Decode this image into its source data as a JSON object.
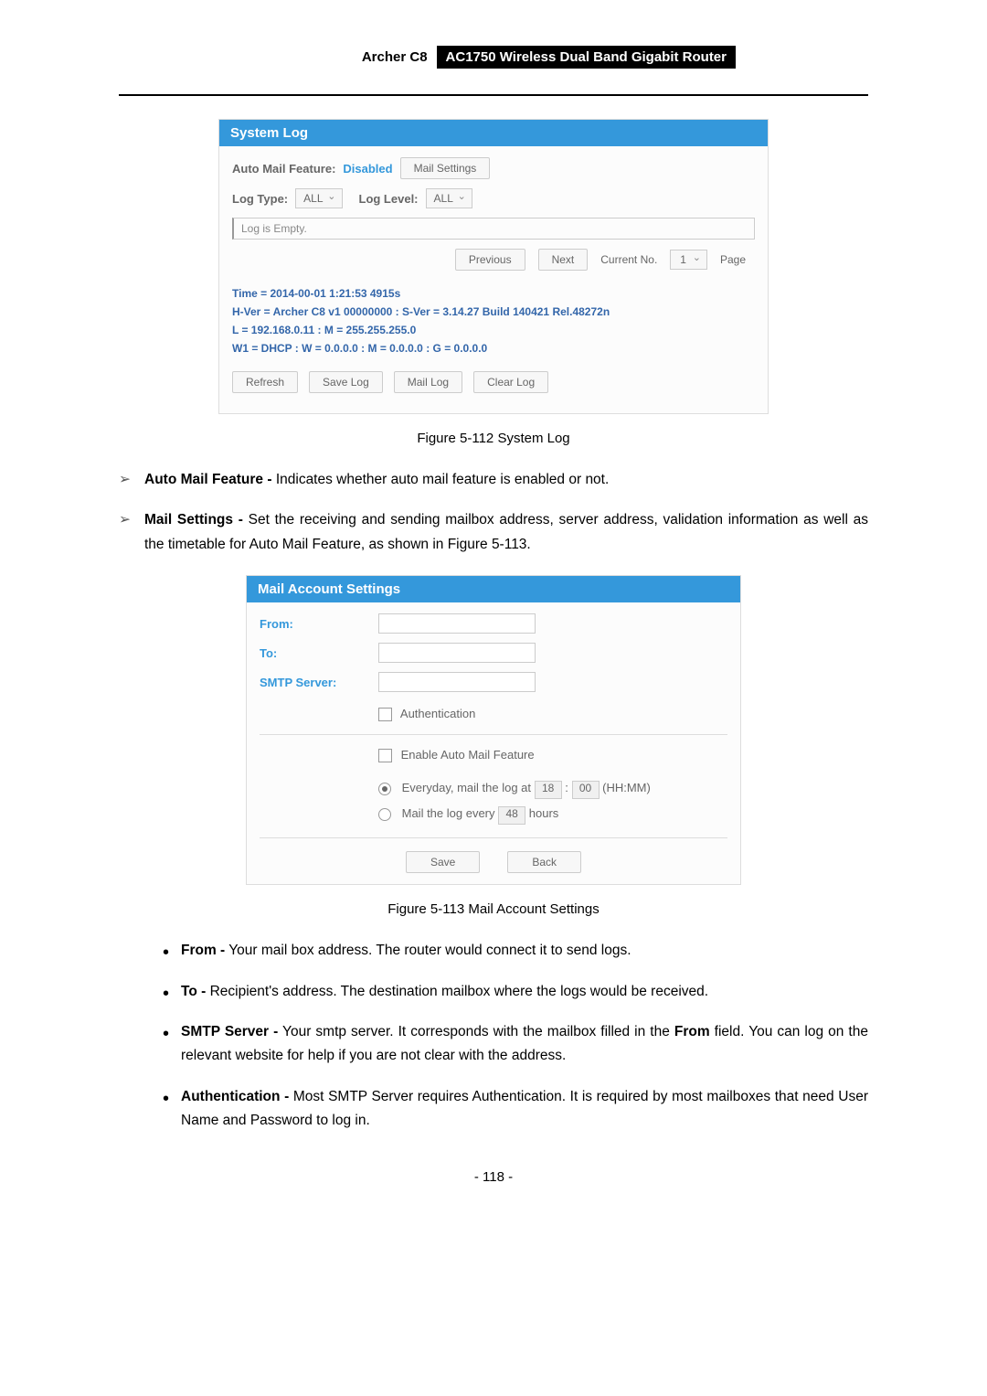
{
  "header": {
    "model": "Archer C8",
    "desc": "AC1750 Wireless Dual Band Gigabit Router"
  },
  "syslog": {
    "title": "System Log",
    "auto_mail_label": "Auto Mail Feature:",
    "auto_mail_value": "Disabled",
    "mail_settings_btn": "Mail Settings",
    "log_type_label": "Log Type:",
    "log_type_value": "ALL",
    "log_level_label": "Log Level:",
    "log_level_value": "ALL",
    "empty_text": "Log is Empty.",
    "prev_btn": "Previous",
    "next_btn": "Next",
    "current_no_label": "Current No.",
    "current_no_value": "1",
    "page_label": "Page",
    "info_time": "Time = 2014-00-01 1:21:53 4915s",
    "info_hver": "H-Ver = Archer C8 v1 00000000 : S-Ver = 3.14.27 Build 140421 Rel.48272n",
    "info_l": "L = 192.168.0.11 : M = 255.255.255.0",
    "info_w1": "W1 = DHCP : W = 0.0.0.0 : M = 0.0.0.0 : G = 0.0.0.0",
    "refresh": "Refresh",
    "save_log": "Save Log",
    "mail_log": "Mail Log",
    "clear_log": "Clear Log"
  },
  "caption1": "Figure 5-112 System Log",
  "bullet1_label": "Auto Mail Feature -",
  "bullet1_text": " Indicates whether auto mail feature is enabled or not.",
  "bullet2_label": "Mail Settings -",
  "bullet2_text": " Set the receiving and sending mailbox address, server address, validation information as well as the timetable for Auto Mail Feature, as shown in Figure 5-113.",
  "mail": {
    "title": "Mail Account Settings",
    "from": "From:",
    "to": "To:",
    "smtp": "SMTP Server:",
    "auth": "Authentication",
    "enable": "Enable Auto Mail Feature",
    "everyday_pre": "Everyday, mail the log at",
    "hh": "18",
    "mm": "00",
    "hhmm": "(HH:MM)",
    "mail_every_pre": "Mail the log every",
    "hours_val": "48",
    "hours": "hours",
    "save": "Save",
    "back": "Back"
  },
  "caption2": "Figure 5-113 Mail Account Settings",
  "sub_bullets": {
    "from_label": "From -",
    "from_text": " Your mail box address. The router would connect it to send logs.",
    "to_label": "To -",
    "to_text": " Recipient's address. The destination mailbox where the logs would be received.",
    "smtp_label": "SMTP Server -",
    "smtp_text1": " Your smtp server. It corresponds with the mailbox filled in the ",
    "smtp_bold": "From",
    "smtp_text2": " field. You can log on the relevant website for help if you are not clear with the address.",
    "auth_label": "Authentication -",
    "auth_text": " Most SMTP Server requires Authentication. It is required by most mailboxes that need User Name and Password to log in."
  },
  "page_num": "- 118 -"
}
